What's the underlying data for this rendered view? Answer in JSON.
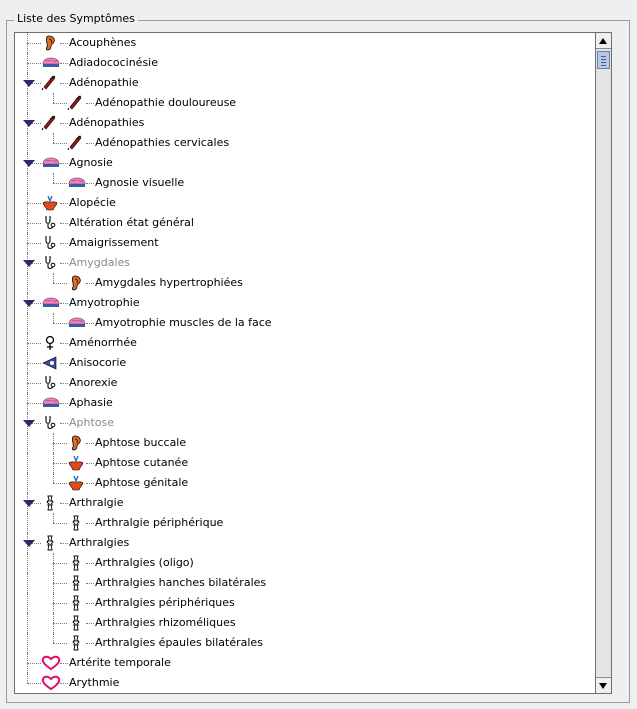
{
  "group": {
    "title": "Liste des Symptômes"
  },
  "items": [
    {
      "label": "Acouphènes",
      "icon": "ear-icon",
      "level": 0,
      "expanded": false
    },
    {
      "label": "Adiadococinésie",
      "icon": "brain-icon",
      "level": 0,
      "expanded": false
    },
    {
      "label": "Adénopathie",
      "icon": "syringe-icon",
      "level": 0,
      "expanded": true
    },
    {
      "label": "Adénopathie douloureuse",
      "icon": "syringe-icon",
      "level": 1
    },
    {
      "label": "Adénopathies",
      "icon": "syringe-icon",
      "level": 0,
      "expanded": true
    },
    {
      "label": "Adénopathies cervicales",
      "icon": "syringe-icon",
      "level": 1
    },
    {
      "label": "Agnosie",
      "icon": "brain-icon",
      "level": 0,
      "expanded": true
    },
    {
      "label": "Agnosie visuelle",
      "icon": "brain-icon",
      "level": 1
    },
    {
      "label": "Alopécie",
      "icon": "skin-icon",
      "level": 0,
      "expanded": false
    },
    {
      "label": "Altération état général",
      "icon": "stethoscope-icon",
      "level": 0,
      "expanded": false
    },
    {
      "label": "Amaigrissement",
      "icon": "stethoscope-icon",
      "level": 0,
      "expanded": false
    },
    {
      "label": "Amygdales",
      "icon": "stethoscope-icon",
      "level": 0,
      "expanded": true,
      "disabled": true
    },
    {
      "label": "Amygdales hypertrophiées",
      "icon": "ear-icon",
      "level": 1
    },
    {
      "label": "Amyotrophie",
      "icon": "brain-icon",
      "level": 0,
      "expanded": true
    },
    {
      "label": "Amyotrophie muscles de la face",
      "icon": "brain-icon",
      "level": 1
    },
    {
      "label": "Aménorrhée",
      "icon": "female-symbol-icon",
      "level": 0,
      "expanded": false
    },
    {
      "label": "Anisocorie",
      "icon": "eye-icon",
      "level": 0,
      "expanded": false
    },
    {
      "label": "Anorexie",
      "icon": "stethoscope-icon",
      "level": 0,
      "expanded": false
    },
    {
      "label": "Aphasie",
      "icon": "brain-icon",
      "level": 0,
      "expanded": false
    },
    {
      "label": "Aphtose",
      "icon": "stethoscope-icon",
      "level": 0,
      "expanded": true,
      "disabled": true
    },
    {
      "label": "Aphtose buccale",
      "icon": "ear-icon",
      "level": 1
    },
    {
      "label": "Aphtose cutanée",
      "icon": "skin-icon",
      "level": 1
    },
    {
      "label": "Aphtose génitale",
      "icon": "skin-icon",
      "level": 1
    },
    {
      "label": "Arthralgie",
      "icon": "joint-icon",
      "level": 0,
      "expanded": true
    },
    {
      "label": "Arthralgie périphérique",
      "icon": "joint-icon",
      "level": 1
    },
    {
      "label": "Arthralgies",
      "icon": "joint-icon",
      "level": 0,
      "expanded": true
    },
    {
      "label": "Arthralgies (oligo)",
      "icon": "joint-icon",
      "level": 1
    },
    {
      "label": "Arthralgies hanches bilatérales",
      "icon": "joint-icon",
      "level": 1
    },
    {
      "label": "Arthralgies périphériques",
      "icon": "joint-icon",
      "level": 1
    },
    {
      "label": "Arthralgies rhizoméliques",
      "icon": "joint-icon",
      "level": 1
    },
    {
      "label": "Arthralgies épaules bilatérales",
      "icon": "joint-icon",
      "level": 1
    },
    {
      "label": "Artérite temporale",
      "icon": "heart-icon",
      "level": 0,
      "expanded": false
    },
    {
      "label": "Arythmie",
      "icon": "heart-icon",
      "level": 0,
      "expanded": false
    }
  ],
  "colors": {
    "ear": "#e07020",
    "brain": "#ee88bb",
    "syringe": "#a01818",
    "skin": "#e04a1a",
    "heart": "#e0106a",
    "eye": "#3a4aa0",
    "tree_line": "#7a7a7a",
    "scroll_thumb": "#b8c9e8"
  }
}
